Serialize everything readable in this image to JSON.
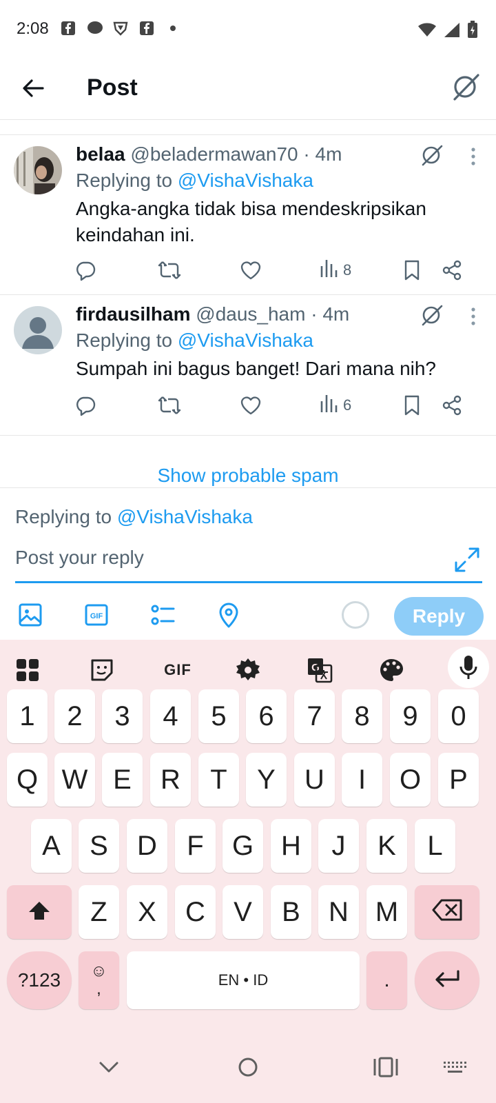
{
  "status_bar": {
    "time": "2:08"
  },
  "header": {
    "title": "Post"
  },
  "tweets": [
    {
      "name": "belaa",
      "handle": "@beladermawan70",
      "time": "· 4m",
      "replying_prefix": "Replying to",
      "replying_to": "@VishaVishaka",
      "text": "Angka-angka tidak bisa mendeskripsikan keindahan ini.",
      "views": "8"
    },
    {
      "name": "firdausilham",
      "handle": "@daus_ham",
      "time": "· 4m",
      "replying_prefix": "Replying to",
      "replying_to": "@VishaVishaka",
      "text": "Sumpah ini bagus banget! Dari mana nih?",
      "views": "6"
    }
  ],
  "spam_link": "Show probable spam",
  "composer": {
    "replying_prefix": "Replying to",
    "replying_to": "@VishaVishaka",
    "placeholder": "Post your reply",
    "reply_button": "Reply"
  },
  "keyboard": {
    "gif_label": "GIF",
    "row_numbers": [
      "1",
      "2",
      "3",
      "4",
      "5",
      "6",
      "7",
      "8",
      "9",
      "0"
    ],
    "row1": [
      "Q",
      "W",
      "E",
      "R",
      "T",
      "Y",
      "U",
      "I",
      "O",
      "P"
    ],
    "row2": [
      "A",
      "S",
      "D",
      "F",
      "G",
      "H",
      "J",
      "K",
      "L"
    ],
    "row3": [
      "Z",
      "X",
      "C",
      "V",
      "B",
      "N",
      "M"
    ],
    "symbols_key": "?123",
    "emoji_key_top": "☺",
    "emoji_key_bottom": ",",
    "space_label": "EN • ID",
    "period_key": "."
  },
  "colors": {
    "accent": "#1d9bf0",
    "reply_button": "#8ecdf8",
    "keyboard_bg": "#fae8ea",
    "special_key": "#f7cdd3"
  }
}
